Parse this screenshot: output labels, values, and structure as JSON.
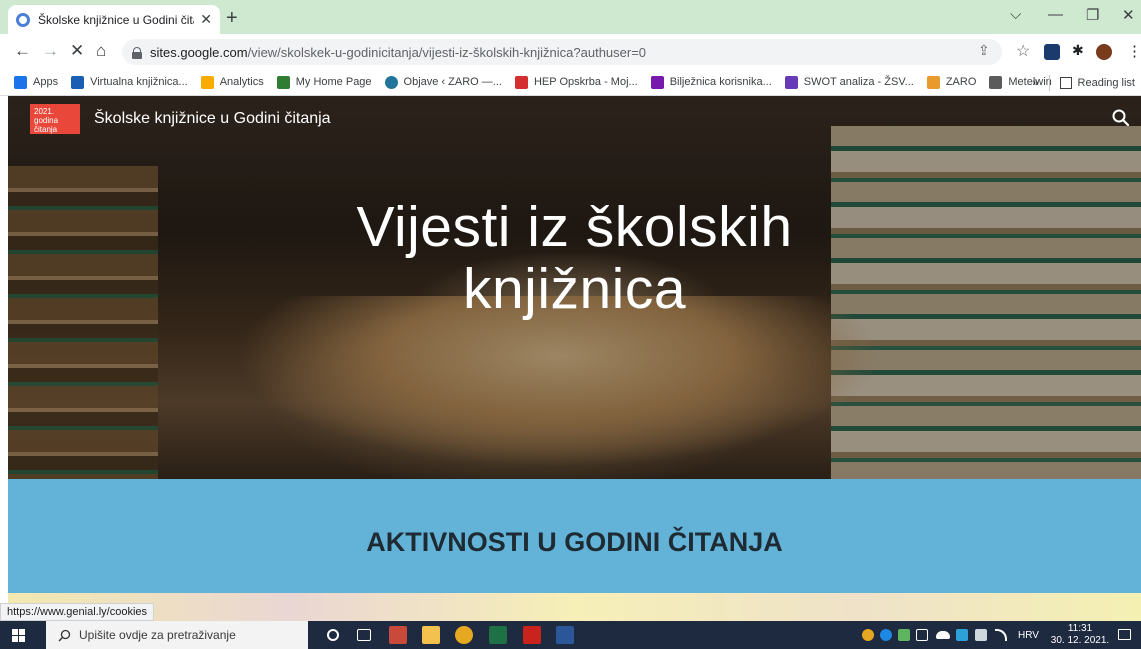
{
  "browser": {
    "tab_title": "Školske knjižnice u Godini čitanja",
    "tab_close": "✕",
    "new_tab": "+",
    "window_controls": {
      "dropdown": "⌵",
      "minimize": "—",
      "restore": "❐",
      "close": "✕"
    },
    "nav": {
      "back": "←",
      "forward": "→",
      "stop": "✕",
      "home": "⌂"
    },
    "url_host": "sites.google.com",
    "url_path": "/view/skolskek-u-godinicitanja/vijesti-iz-školskih-knjižnica?authuser=0",
    "omnibox_icons": [
      "share-icon",
      "star-icon"
    ],
    "menu": "⋮"
  },
  "bookmarks": {
    "items": [
      {
        "label": "Apps",
        "icon": "apps-grid-icon",
        "color": "#1a73e8"
      },
      {
        "label": "Virtualna knjižnica...",
        "icon": "library-icon",
        "color": "#1a5fb4"
      },
      {
        "label": "Analytics",
        "icon": "analytics-icon",
        "color": "#f9ab00"
      },
      {
        "label": "My Home Page",
        "icon": "homepage-icon",
        "color": "#2e7d32"
      },
      {
        "label": "Objave ‹ ZARO —...",
        "icon": "wordpress-icon",
        "color": "#21759b"
      },
      {
        "label": "HEP Opskrba - Moj...",
        "icon": "hep-icon",
        "color": "#d32f2f"
      },
      {
        "label": "Bilježnica korisnika...",
        "icon": "onenote-icon",
        "color": "#7719aa"
      },
      {
        "label": "SWOT analiza - ŽSV...",
        "icon": "forms-icon",
        "color": "#673ab7"
      },
      {
        "label": "ZARO",
        "icon": "zaro-icon",
        "color": "#e89a2b"
      },
      {
        "label": "Metelwin",
        "icon": "metelwin-icon",
        "color": "#5b5b5b"
      }
    ],
    "overflow": "»",
    "reading_list": "Reading list"
  },
  "site": {
    "logo_text": "2021. godina čitanja",
    "title": "Školske knjižnice u Godini čitanja",
    "hero_line1": "Vijesti iz školskih",
    "hero_line2": "knjižnica",
    "section_title": "AKTIVNOSTI U GODINI ČITANJA"
  },
  "status_bar_url": "https://www.genial.ly/cookies",
  "taskbar": {
    "search_placeholder": "Upišite ovdje za pretraživanje",
    "language": "HRV",
    "time": "11:31",
    "date": "30. 12. 2021."
  },
  "colors": {
    "tab_strip": "#cfe8d0",
    "band": "#63b3d9",
    "taskbar": "#1d2a3f",
    "logo": "#e8473a"
  }
}
